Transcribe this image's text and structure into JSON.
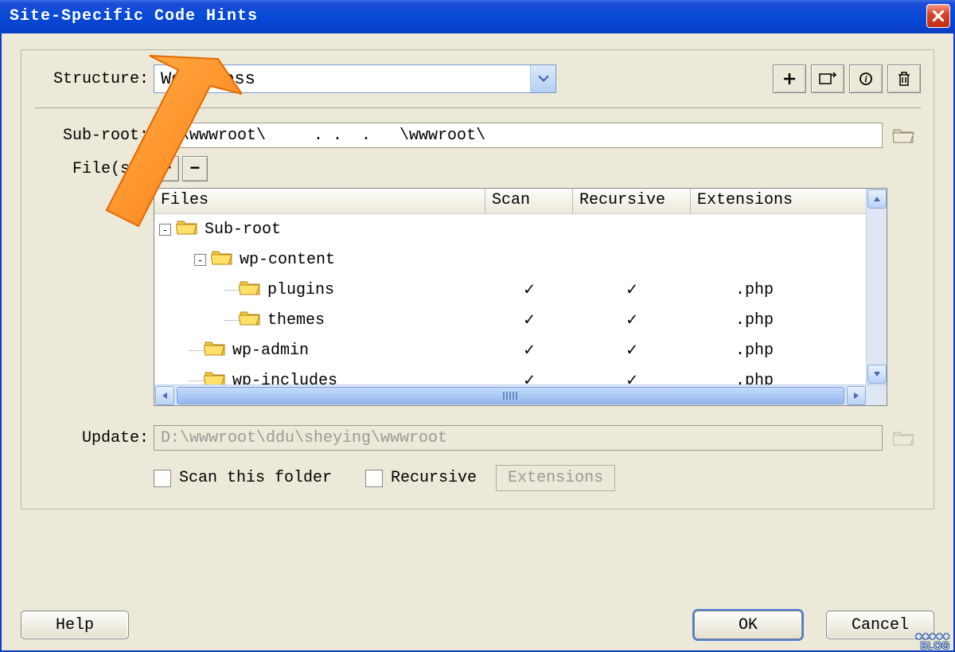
{
  "title": "Site-Specific Code Hints",
  "structure": {
    "label": "Structure:",
    "value": "Wordpress"
  },
  "subroot": {
    "label": "Sub-root:",
    "value": "D.\\wwwroot\\     . .  .   \\wwwroot\\"
  },
  "files_label": "File(s):",
  "columns": {
    "files": "Files",
    "scan": "Scan",
    "recursive": "Recursive",
    "extensions": "Extensions"
  },
  "tree": [
    {
      "indent": 0,
      "toggle": "-",
      "name": "Sub-root",
      "scan": "",
      "recursive": "",
      "ext": ""
    },
    {
      "indent": 1,
      "toggle": "-",
      "name": "wp-content",
      "scan": "",
      "recursive": "",
      "ext": ""
    },
    {
      "indent": 2,
      "toggle": "",
      "name": "plugins",
      "scan": "✓",
      "recursive": "✓",
      "ext": ".php"
    },
    {
      "indent": 2,
      "toggle": "",
      "name": "themes",
      "scan": "✓",
      "recursive": "✓",
      "ext": ".php"
    },
    {
      "indent": 1,
      "toggle": "",
      "name": "wp-admin",
      "scan": "✓",
      "recursive": "✓",
      "ext": ".php"
    },
    {
      "indent": 1,
      "toggle": "",
      "name": "wp-includes",
      "scan": "✓",
      "recursive": "✓",
      "ext": ".php"
    }
  ],
  "update": {
    "label": "Update:",
    "value": "D:\\wwwroot\\ddu\\sheying\\wwwroot"
  },
  "checkboxes": {
    "scan_folder": "Scan this folder",
    "recursive": "Recursive",
    "extensions": "Extensions"
  },
  "buttons": {
    "help": "Help",
    "ok": "OK",
    "cancel": "Cancel"
  },
  "watermark": "BLOG"
}
